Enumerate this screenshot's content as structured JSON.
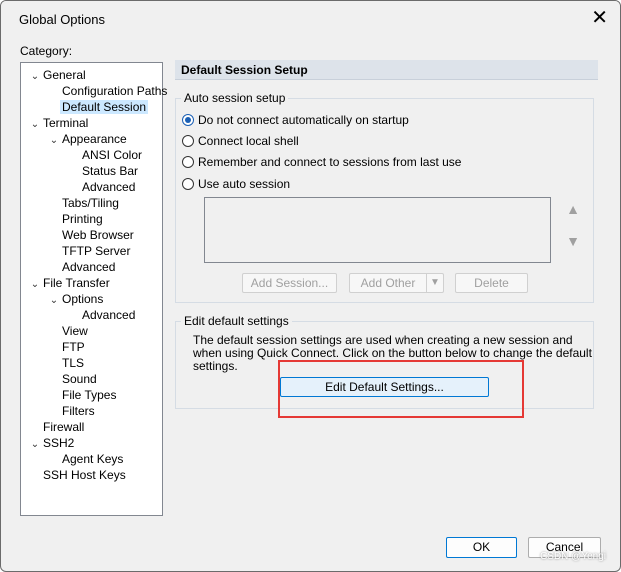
{
  "window": {
    "title": "Global Options",
    "close_glyph": "✕"
  },
  "category": {
    "label": "Category:"
  },
  "tree": [
    {
      "label": "General",
      "level": 0,
      "expanded": true,
      "selected": false
    },
    {
      "label": "Configuration Paths",
      "level": 1,
      "expanded": null,
      "selected": false
    },
    {
      "label": "Default Session",
      "level": 1,
      "expanded": null,
      "selected": true
    },
    {
      "label": "Terminal",
      "level": 0,
      "expanded": true,
      "selected": false
    },
    {
      "label": "Appearance",
      "level": 1,
      "expanded": true,
      "selected": false
    },
    {
      "label": "ANSI Color",
      "level": 2,
      "expanded": null,
      "selected": false
    },
    {
      "label": "Status Bar",
      "level": 2,
      "expanded": null,
      "selected": false
    },
    {
      "label": "Advanced",
      "level": 2,
      "expanded": null,
      "selected": false
    },
    {
      "label": "Tabs/Tiling",
      "level": 1,
      "expanded": null,
      "selected": false
    },
    {
      "label": "Printing",
      "level": 1,
      "expanded": null,
      "selected": false
    },
    {
      "label": "Web Browser",
      "level": 1,
      "expanded": null,
      "selected": false
    },
    {
      "label": "TFTP Server",
      "level": 1,
      "expanded": null,
      "selected": false
    },
    {
      "label": "Advanced",
      "level": 1,
      "expanded": null,
      "selected": false
    },
    {
      "label": "File Transfer",
      "level": 0,
      "expanded": true,
      "selected": false
    },
    {
      "label": "Options",
      "level": 1,
      "expanded": true,
      "selected": false
    },
    {
      "label": "Advanced",
      "level": 2,
      "expanded": null,
      "selected": false
    },
    {
      "label": "View",
      "level": 1,
      "expanded": null,
      "selected": false
    },
    {
      "label": "FTP",
      "level": 1,
      "expanded": null,
      "selected": false
    },
    {
      "label": "TLS",
      "level": 1,
      "expanded": null,
      "selected": false
    },
    {
      "label": "Sound",
      "level": 1,
      "expanded": null,
      "selected": false
    },
    {
      "label": "File Types",
      "level": 1,
      "expanded": null,
      "selected": false
    },
    {
      "label": "Filters",
      "level": 1,
      "expanded": null,
      "selected": false
    },
    {
      "label": "Firewall",
      "level": 0,
      "expanded": null,
      "selected": false
    },
    {
      "label": "SSH2",
      "level": 0,
      "expanded": true,
      "selected": false
    },
    {
      "label": "Agent Keys",
      "level": 1,
      "expanded": null,
      "selected": false
    },
    {
      "label": "SSH Host Keys",
      "level": 0,
      "expanded": null,
      "selected": false
    }
  ],
  "panel": {
    "header": "Default Session Setup",
    "auto_group": {
      "legend": "Auto session setup",
      "options": [
        {
          "label": "Do not connect automatically on startup",
          "checked": true
        },
        {
          "label": "Connect local shell",
          "checked": false
        },
        {
          "label": "Remember and connect to sessions from last use",
          "checked": false
        },
        {
          "label": "Use auto session",
          "checked": false
        }
      ],
      "up_glyph": "▲",
      "down_glyph": "▼",
      "add_session": "Add Session...",
      "add_other": "Add Other",
      "add_other_arrow": "▼",
      "delete": "Delete"
    },
    "edit_group": {
      "legend": "Edit default settings",
      "description": "The default session settings are used when creating a new session and when using Quick Connect.  Click on the button below to change the default settings.",
      "button": "Edit Default Settings..."
    }
  },
  "footer": {
    "ok": "OK",
    "cancel": "Cancel"
  },
  "watermark": "CSDN @Yengi",
  "colors": {
    "highlight": "#e53935",
    "selection": "#cce8ff",
    "accent": "#0078d4"
  }
}
